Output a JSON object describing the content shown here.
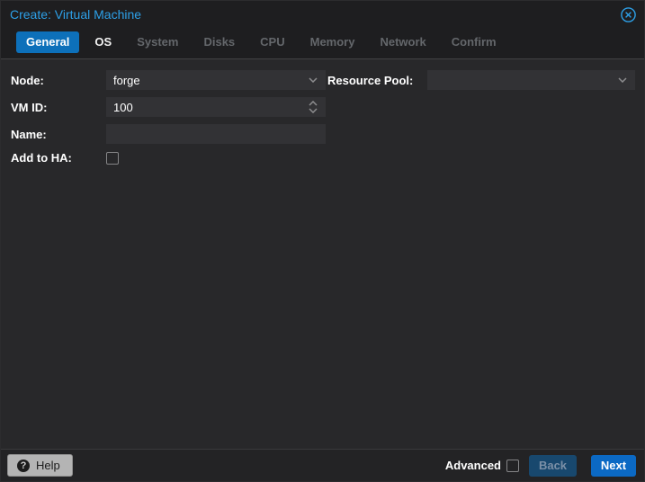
{
  "window": {
    "title": "Create: Virtual Machine",
    "close_icon": "circle-x"
  },
  "tabs": {
    "items": [
      {
        "label": "General",
        "state": "active"
      },
      {
        "label": "OS",
        "state": "enabled"
      },
      {
        "label": "System",
        "state": "disabled"
      },
      {
        "label": "Disks",
        "state": "disabled"
      },
      {
        "label": "CPU",
        "state": "disabled"
      },
      {
        "label": "Memory",
        "state": "disabled"
      },
      {
        "label": "Network",
        "state": "disabled"
      },
      {
        "label": "Confirm",
        "state": "disabled"
      }
    ]
  },
  "form": {
    "node": {
      "label": "Node:",
      "value": "forge",
      "control": "combobox"
    },
    "vmid": {
      "label": "VM ID:",
      "value": "100",
      "control": "number-spinner"
    },
    "name": {
      "label": "Name:",
      "value": "",
      "control": "textfield"
    },
    "add_to_ha": {
      "label": "Add to HA:",
      "checked": false,
      "control": "checkbox"
    },
    "resource_pool": {
      "label": "Resource Pool:",
      "value": "",
      "control": "combobox"
    }
  },
  "footer": {
    "help_label": "Help",
    "help_icon": "question-circle",
    "advanced_label": "Advanced",
    "advanced_checked": false,
    "back_label": "Back",
    "back_enabled": false,
    "next_label": "Next",
    "next_enabled": true
  },
  "colors": {
    "title_accent": "#2da0e8",
    "active_tab_bg": "#0d70ba",
    "body_bg": "#28282a",
    "header_bg": "#1e1e20",
    "field_bg": "#323235",
    "next_button_bg": "#0b69c4",
    "back_button_bg": "#18486e",
    "help_button_bg": "#b4b4b4"
  }
}
